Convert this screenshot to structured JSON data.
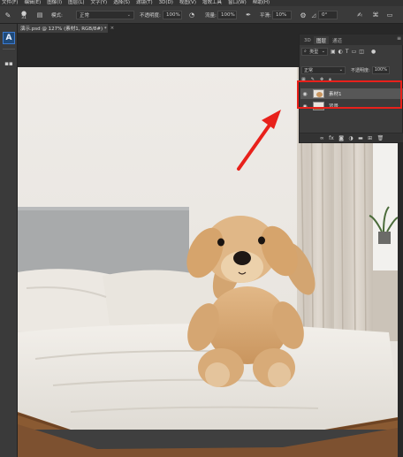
{
  "menu": [
    "文件(F)",
    "编辑(E)",
    "图像(I)",
    "图层(L)",
    "文字(Y)",
    "选择(S)",
    "滤镜(T)",
    "3D(D)",
    "视图(V)",
    "增效工具",
    "窗口(W)",
    "帮助(H)"
  ],
  "options": {
    "brush_size": "31",
    "mode_label": "模式:",
    "mode_value": "正常",
    "opacity_label": "不透明度:",
    "opacity_value": "100%",
    "flow_label": "流量:",
    "flow_value": "100%",
    "smooth_label": "平滑:",
    "smooth_value": "10%",
    "angle_value": "0°"
  },
  "document_tab": {
    "title": "演示.psd @ 127% (素材1, RGB/8#) *",
    "close": "×"
  },
  "layers_panel": {
    "tabs": [
      "3D",
      "图层",
      "通道"
    ],
    "filter_kind": "类型",
    "blend_mode": "正常",
    "opacity_label": "不透明度:",
    "opacity_value": "100%",
    "layers": [
      {
        "name": "素材1",
        "selected": true
      },
      {
        "name": "背景",
        "selected": false
      }
    ],
    "footer_icons": [
      "link-icon",
      "fx-icon",
      "mask-icon",
      "adjustment-icon",
      "folder-icon",
      "new-layer-icon",
      "trash-icon"
    ]
  },
  "colors": {
    "accent_red": "#e8211b",
    "panel_bg": "#3b3b3b",
    "selected_layer": "#575757"
  }
}
